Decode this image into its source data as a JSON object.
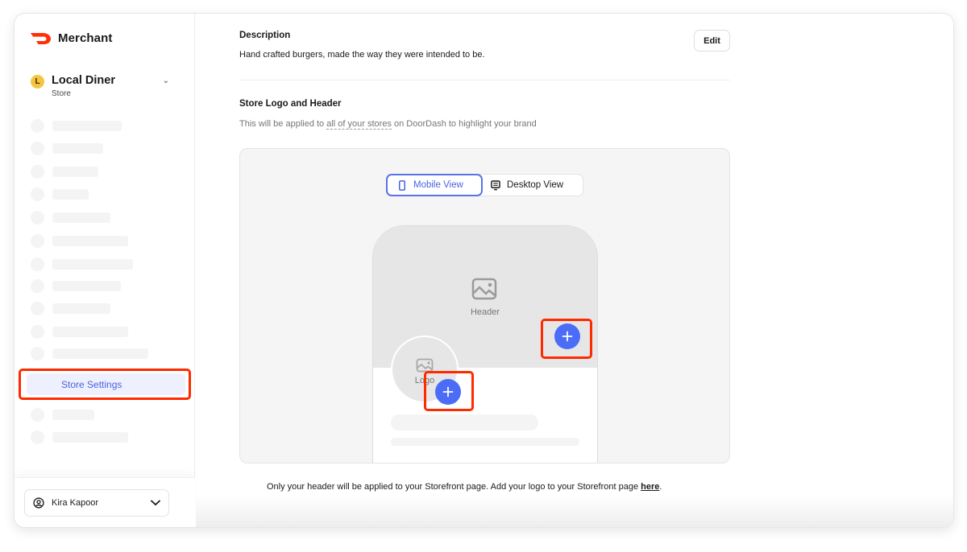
{
  "brand": {
    "name": "Merchant",
    "logo_icon": "doordash-logo-icon",
    "logo_color": "#ff3008"
  },
  "store": {
    "initial": "L",
    "name": "Local Diner",
    "type": "Store",
    "chevron_icon": "chevron-down-icon"
  },
  "sidebar": {
    "active_item": {
      "label": "Store Settings",
      "color": "#4a62e0"
    },
    "skeleton_rows_before": 11,
    "skeleton_rows_after": 2
  },
  "user": {
    "name": "Kira Kapoor",
    "icon": "user-circle-icon",
    "chevron_icon": "chevron-down-icon"
  },
  "description": {
    "label": "Description",
    "text": "Hand crafted burgers, made the way they were intended to be.",
    "edit_label": "Edit"
  },
  "logo_header": {
    "label": "Store Logo and Header",
    "help_prefix": "This will be applied to ",
    "help_link": "all of your stores",
    "help_suffix": " on DoorDash to highlight your brand"
  },
  "preview": {
    "views": [
      {
        "label": "Mobile View",
        "icon": "mobile-icon",
        "active": true
      },
      {
        "label": "Desktop View",
        "icon": "desktop-icon",
        "active": false
      }
    ],
    "header_placeholder": "Header",
    "logo_placeholder": "Logo",
    "add_button_color": "#4a6cf7",
    "highlight_color": "#ff2a00"
  },
  "footer": {
    "note_prefix": "Only your header will be applied to your Storefront page. Add your logo to your Storefront page ",
    "note_link": "here",
    "note_suffix": "."
  }
}
